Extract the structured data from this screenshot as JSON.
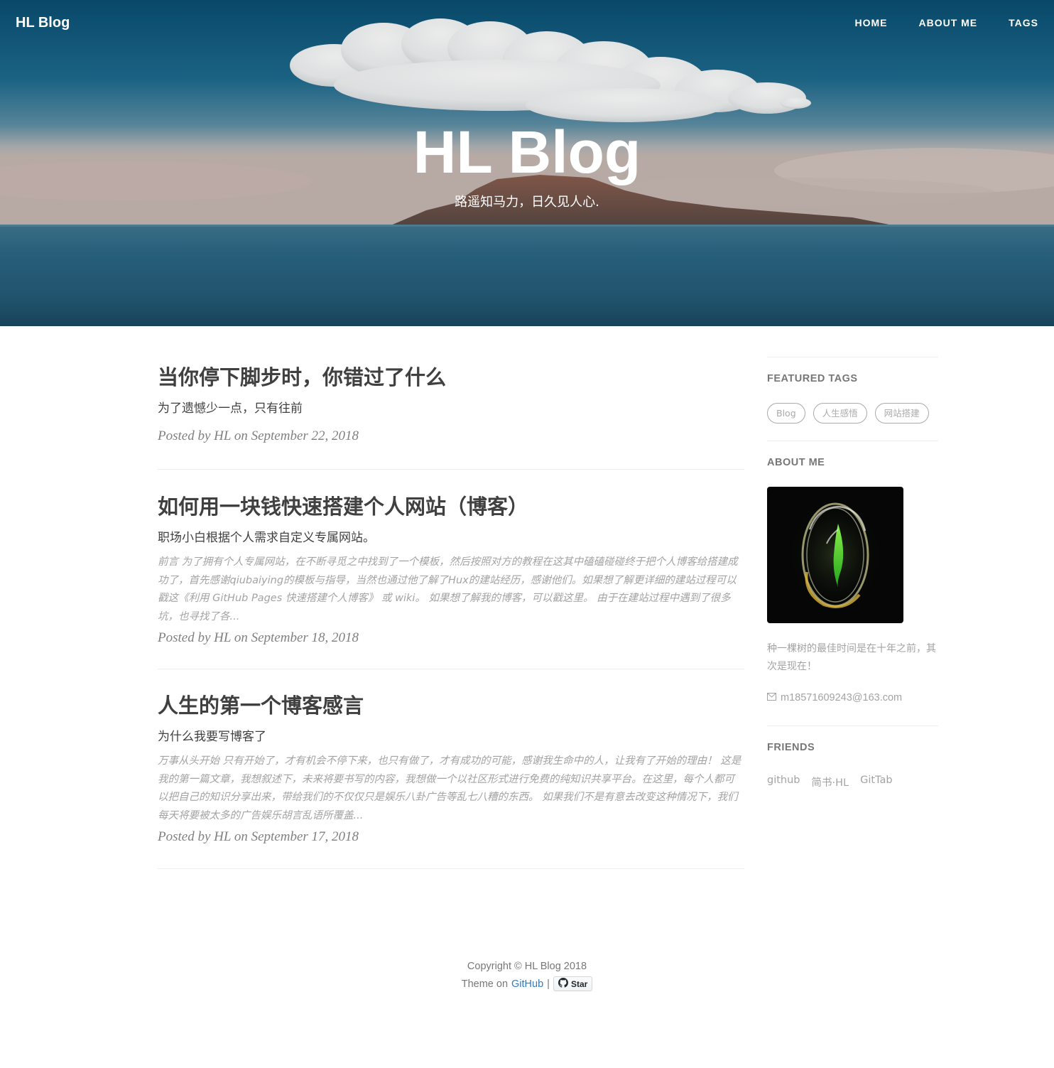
{
  "nav": {
    "brand": "HL Blog",
    "links": [
      "HOME",
      "ABOUT ME",
      "TAGS"
    ]
  },
  "hero": {
    "title": "HL Blog",
    "subtitle": "路遥知马力，日久见人心."
  },
  "posts": [
    {
      "title": "当你停下脚步时，你错过了什么",
      "subtitle": "为了遗憾少一点，只有往前",
      "excerpt": "",
      "meta": "Posted by HL on September 22, 2018"
    },
    {
      "title": "如何用一块钱快速搭建个人网站（博客）",
      "subtitle": "职场小白根据个人需求自定义专属网站。",
      "excerpt": "前言 为了拥有个人专属网站，在不断寻觅之中找到了一个模板，然后按照对方的教程在这其中磕磕碰碰终于把个人博客给搭建成功了，首先感谢qiubaiying的模板与指导，当然也通过他了解了Hux的建站经历，感谢他们。如果想了解更详细的建站过程可以戳这《利用 GitHub Pages 快速搭建个人博客》 或 wiki。 如果想了解我的博客，可以戳这里。 由于在建站过程中遇到了很多坑，也寻找了各...",
      "meta": "Posted by HL on September 18, 2018"
    },
    {
      "title": "人生的第一个博客感言",
      "subtitle": "为什么我要写博客了",
      "excerpt": "万事从头开始 只有开始了，才有机会不停下来，也只有做了，才有成功的可能，感谢我生命中的人，让我有了开始的理由！ 这是我的第一篇文章，我想叙述下，未来将要书写的内容，我想做一个以社区形式进行免费的纯知识共享平台。在这里，每个人都可以把自己的知识分享出来，带给我们的不仅仅只是娱乐八卦广告等乱七八糟的东西。 如果我们不是有意去改变这种情况下，我们每天将要被太多的广告娱乐胡言乱语所覆盖...",
      "meta": "Posted by HL on September 17, 2018"
    }
  ],
  "sidebar": {
    "featured_tags": {
      "heading": "FEATURED TAGS",
      "tags": [
        "Blog",
        "人生感悟",
        "网站搭建"
      ]
    },
    "about": {
      "heading": "ABOUT ME",
      "bio": "种一棵树的最佳时间是在十年之前，其次是现在！",
      "email": "m18571609243@163.com",
      "email_icon": "envelope-icon"
    },
    "friends": {
      "heading": "FRIENDS",
      "links": [
        "github",
        "简书·HL",
        "GitTab"
      ]
    }
  },
  "footer": {
    "copyright": "Copyright © HL Blog 2018",
    "theme_prefix": "Theme on",
    "theme_link": "GitHub",
    "separator": "|",
    "star_label": "Star",
    "star_icon": "github-icon"
  },
  "colors": {
    "link": "#337ab7",
    "muted": "#a3a3a3",
    "text": "#404040"
  }
}
